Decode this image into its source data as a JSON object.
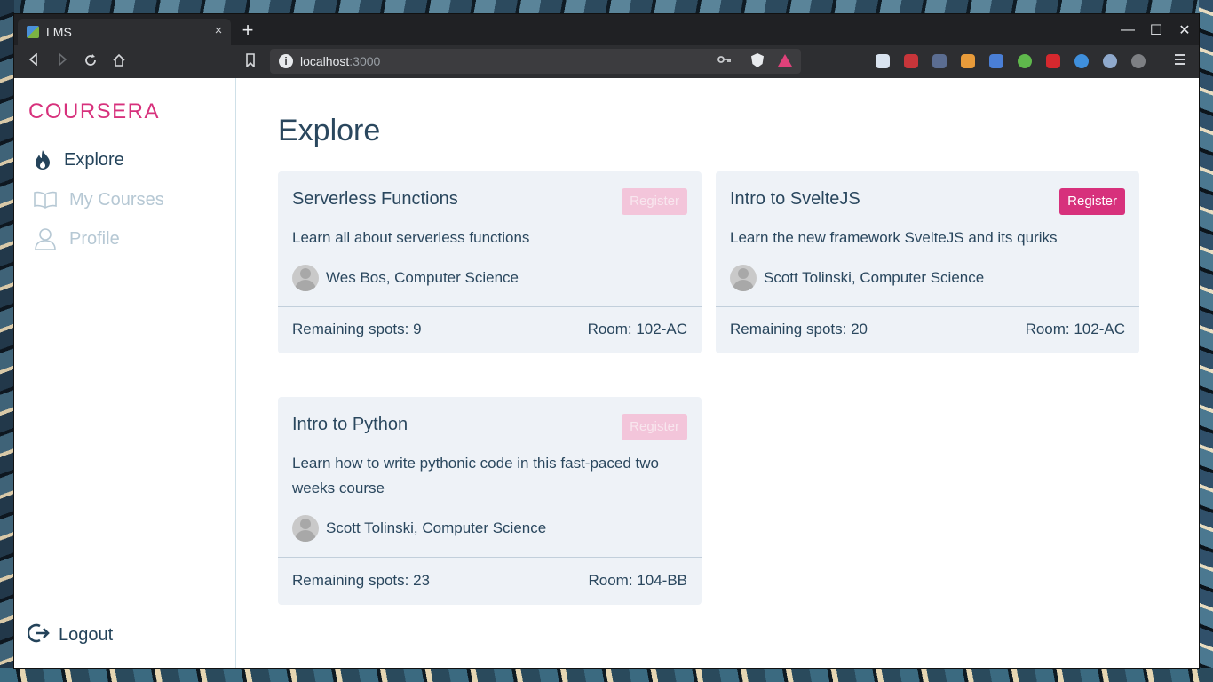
{
  "browser": {
    "tab_title": "LMS",
    "tab_close": "×",
    "new_tab": "+",
    "url_host": "localhost",
    "url_port": ":3000",
    "info_glyph": "i",
    "window_controls": [
      "—",
      "☐",
      "✕"
    ]
  },
  "sidebar": {
    "brand": "COURSERA",
    "items": [
      {
        "label": "Explore",
        "icon": "flame-icon",
        "active": true
      },
      {
        "label": "My Courses",
        "icon": "book-icon",
        "active": false
      },
      {
        "label": "Profile",
        "icon": "user-icon",
        "active": false
      }
    ],
    "logout": "Logout"
  },
  "main": {
    "heading": "Explore",
    "courses": [
      {
        "title": "Serverless Functions",
        "register_label": "Register",
        "register_enabled": false,
        "description": "Learn all about serverless functions",
        "instructor": "Wes Bos, Computer Science",
        "remaining": "Remaining spots: 9",
        "room": "Room: 102-AC"
      },
      {
        "title": "Intro to SvelteJS",
        "register_label": "Register",
        "register_enabled": true,
        "description": "Learn the new framework SvelteJS and its quriks",
        "instructor": "Scott Tolinski, Computer Science",
        "remaining": "Remaining spots: 20",
        "room": "Room: 102-AC"
      },
      {
        "title": "Intro to Python",
        "register_label": "Register",
        "register_enabled": false,
        "description": "Learn how to write pythonic code in this fast-paced two weeks course",
        "instructor": "Scott Tolinski, Computer Science",
        "remaining": "Remaining spots: 23",
        "room": "Room: 104-BB"
      }
    ]
  },
  "colors": {
    "brand": "#d7317c",
    "text": "#2a475e",
    "inactive": "#b6c8d4",
    "card_bg": "#eef2f7"
  }
}
